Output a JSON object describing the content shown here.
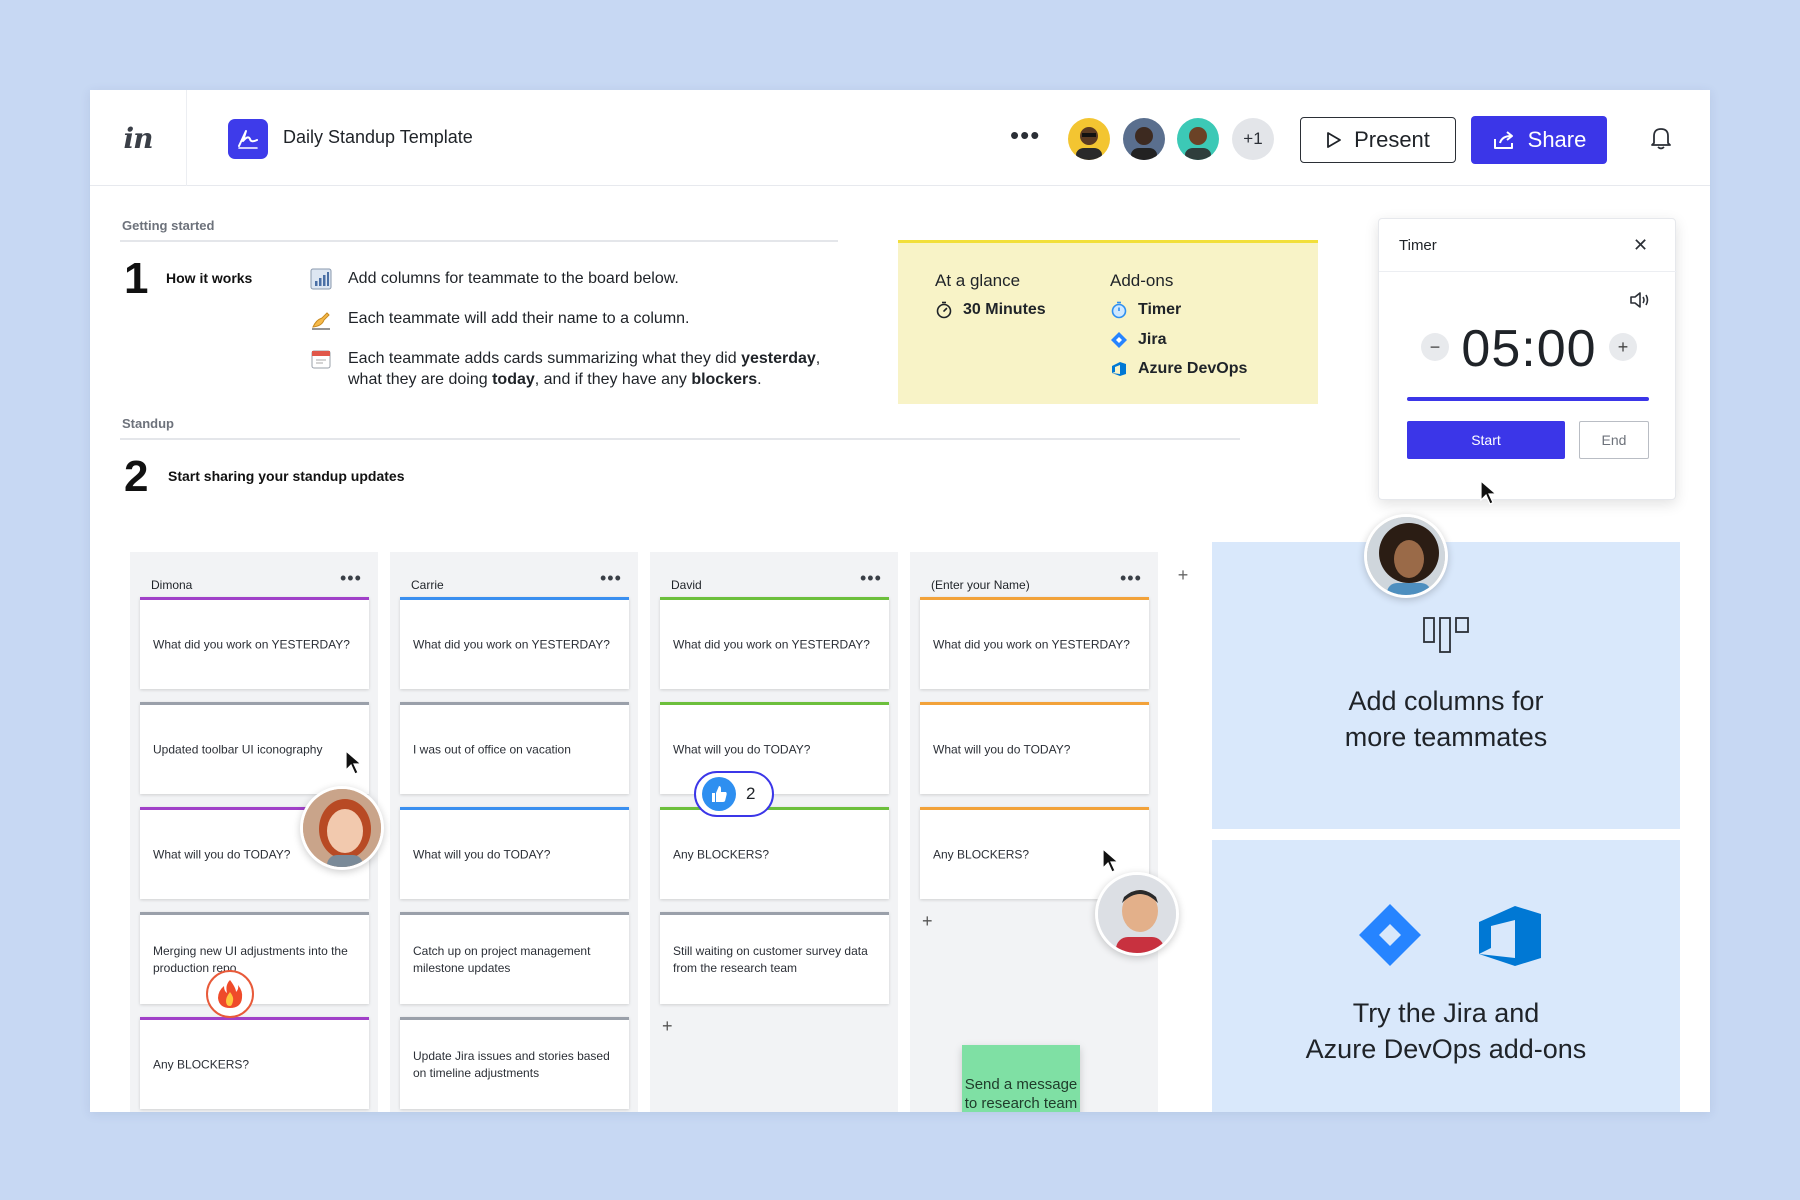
{
  "colors": {
    "accent": "#3b36e8",
    "background": "#c7d8f3",
    "glance_bg": "#f8f3c7",
    "promo_bg": "#d9e8fb",
    "sticky": "#7fe0a4"
  },
  "header": {
    "logo": "in",
    "doc_title": "Daily Standup Template",
    "more_label": "•••",
    "avatar_more": "+1",
    "present_label": "Present",
    "share_label": "Share"
  },
  "getting_started": {
    "label": "Getting started",
    "step_number": "1",
    "step_title": "How it works",
    "instructions": [
      {
        "icon": "bar-chart-icon",
        "text": "Add columns for teammate to the board below."
      },
      {
        "icon": "writing-hand-icon",
        "text": "Each teammate will add their name to a column."
      },
      {
        "icon": "calendar-icon",
        "before": "Each teammate adds cards summarizing what they did ",
        "b1": "yesterday",
        "after1": ",",
        "line2a": "what they are doing ",
        "b2": "today",
        "line2b": ", and if they have any ",
        "b3": "blockers",
        "line2c": "."
      }
    ]
  },
  "glance": {
    "at_a_glance": "At a glance",
    "duration": "30 Minutes",
    "addons_label": "Add-ons",
    "addons": [
      "Timer",
      "Jira",
      "Azure DevOps"
    ]
  },
  "timer": {
    "title": "Timer",
    "close": "✕",
    "time": "05:00",
    "minus": "−",
    "plus": "+",
    "start": "Start",
    "end": "End",
    "progress": 1.0
  },
  "standup": {
    "label": "Standup",
    "step_number": "2",
    "step_title": "Start sharing your standup updates"
  },
  "board": {
    "more_label": "•••",
    "add_card": "+",
    "add_column": "+",
    "columns": [
      {
        "name": "Dimona",
        "cards": [
          {
            "text": "What did you work on YESTERDAY?",
            "color": "#a040c8"
          },
          {
            "text": "Updated toolbar UI iconography",
            "color": "#9aa0aa"
          },
          {
            "text": "What will you do TODAY?",
            "color": "#a040c8"
          },
          {
            "text": "Merging new UI adjustments into the production repo",
            "color": "#9aa0aa"
          },
          {
            "text": "Any BLOCKERS?",
            "color": "#a040c8"
          }
        ]
      },
      {
        "name": "Carrie",
        "cards": [
          {
            "text": "What did you work on YESTERDAY?",
            "color": "#3a8ff0"
          },
          {
            "text": "I was out of office on vacation",
            "color": "#9aa0aa"
          },
          {
            "text": "What will you do TODAY?",
            "color": "#3a8ff0"
          },
          {
            "text": "Catch up on project management milestone updates",
            "color": "#9aa0aa"
          },
          {
            "text": "Update Jira issues and stories based on timeline adjustments",
            "color": "#9aa0aa"
          }
        ]
      },
      {
        "name": "David",
        "cards": [
          {
            "text": "What did you work on YESTERDAY?",
            "color": "#6cbf3c"
          },
          {
            "text": "What will you do TODAY?",
            "color": "#6cbf3c"
          },
          {
            "text": "Any BLOCKERS?",
            "color": "#6cbf3c"
          },
          {
            "text": "Still waiting on customer survey data from the research team",
            "color": "#9aa0aa"
          }
        ]
      },
      {
        "name": "(Enter your Name)",
        "cards": [
          {
            "text": "What did you work on YESTERDAY?",
            "color": "#f2a23a"
          },
          {
            "text": "What will you do TODAY?",
            "color": "#f2a23a"
          },
          {
            "text": "Any BLOCKERS?",
            "color": "#f2a23a"
          }
        ]
      }
    ]
  },
  "sticky_note": "Send a message to research team",
  "like_badge": {
    "count": "2"
  },
  "promo": {
    "columns_line1": "Add columns for",
    "columns_line2": "more teammates",
    "addons_line1": "Try the Jira and",
    "addons_line2": "Azure DevOps add-ons"
  }
}
